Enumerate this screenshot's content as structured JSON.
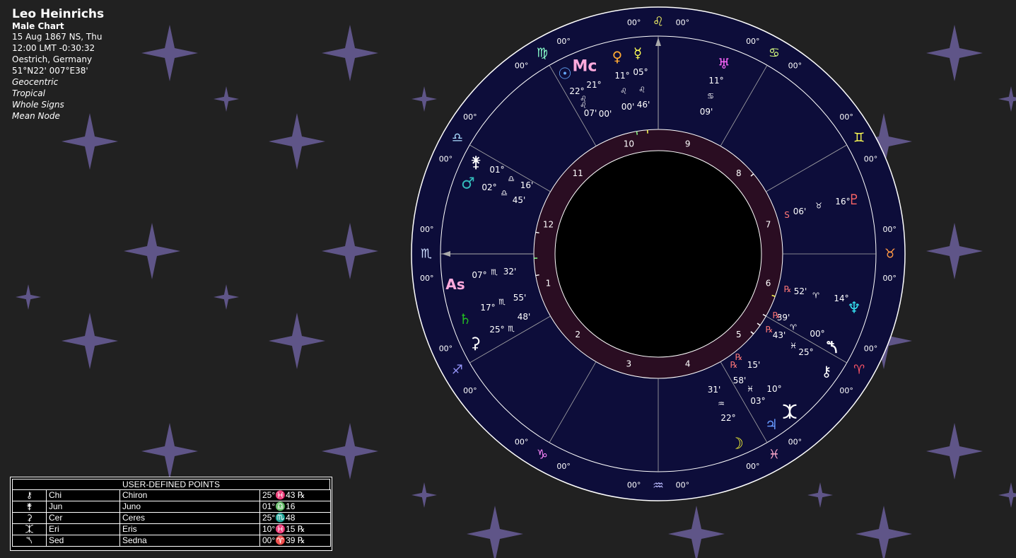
{
  "chart_info": {
    "name": "Leo Heinrichs",
    "chart_type": "Male Chart",
    "date": "15 Aug 1867 NS, Thu",
    "time": "12:00  LMT -0:30:32",
    "place": "Oestrich, Germany",
    "coords": "51°N22' 007°E38'",
    "settings": [
      "Geocentric",
      "Tropical",
      "Whole Signs",
      "Mean Node"
    ]
  },
  "colors": {
    "background": "#212121",
    "wheel_outer": "#0d0d3a",
    "house_ring": "#2a0d22",
    "ring_line": "#ffffff",
    "star": "#5f5588"
  },
  "wheel": {
    "house_numbers": [
      "1",
      "2",
      "3",
      "4",
      "5",
      "6",
      "7",
      "8",
      "9",
      "10",
      "11",
      "12"
    ],
    "degree_marks": [
      "00°",
      "00°",
      "00°",
      "00°",
      "00°",
      "00°",
      "00°",
      "00°",
      "00°",
      "00°",
      "00°",
      "00°",
      "00°",
      "00°",
      "00°",
      "00°",
      "00°",
      "00°",
      "00°",
      "00°",
      "00°",
      "00°",
      "00°",
      "00°"
    ],
    "signs": [
      {
        "glyph": "♌",
        "name": "leo-sign-icon",
        "color": "#ffff66"
      },
      {
        "glyph": "♋",
        "name": "cancer-sign-icon",
        "color": "#d8ff80"
      },
      {
        "glyph": "♊",
        "name": "gemini-sign-icon",
        "color": "#ffff55"
      },
      {
        "glyph": "♉",
        "name": "taurus-sign-icon",
        "color": "#ff9944"
      },
      {
        "glyph": "♈",
        "name": "aries-sign-icon",
        "color": "#ff5566"
      },
      {
        "glyph": "♓",
        "name": "pisces-sign-icon",
        "color": "#ffaacc"
      },
      {
        "glyph": "♒",
        "name": "aquarius-sign-icon",
        "color": "#bbbbff"
      },
      {
        "glyph": "♑",
        "name": "capricorn-sign-icon",
        "color": "#ff88ff"
      },
      {
        "glyph": "♐",
        "name": "sagittarius-sign-icon",
        "color": "#9999ff"
      },
      {
        "glyph": "♏",
        "name": "scorpio-sign-icon",
        "color": "#ccddff"
      },
      {
        "glyph": "♎",
        "name": "libra-sign-icon",
        "color": "#aaddff"
      },
      {
        "glyph": "♍",
        "name": "virgo-sign-icon",
        "color": "#88ffcc"
      }
    ]
  },
  "points": {
    "mc": {
      "glyph": "Mc",
      "deg": "21°",
      "sign": "♌",
      "min": "07'",
      "color": "#ffaadd"
    },
    "sun": {
      "glyph": "☉",
      "deg": "22°",
      "sign": "♌",
      "min": "00'",
      "color": "#66aaff"
    },
    "venus": {
      "glyph": "♀",
      "deg": "11°",
      "sign": "♌",
      "min": "00'",
      "color": "#ffaa33"
    },
    "mercury": {
      "glyph": "☿",
      "deg": "05°",
      "sign": "♌",
      "min": "46'",
      "color": "#ffff55"
    },
    "uranus": {
      "glyph": "♅",
      "deg": "11°",
      "sign": "♋",
      "min": "09'",
      "color": "#ff66ff"
    },
    "pluto": {
      "glyph": "♇",
      "deg": "16°",
      "sign": "♉",
      "min": "06'",
      "retro": "S",
      "color": "#ff6666"
    },
    "neptune": {
      "glyph": "♆",
      "deg": "14°",
      "sign": "♈",
      "min": "52'",
      "retro": "℞",
      "color": "#33ddee"
    },
    "sedna": {
      "glyph": "⯲",
      "deg": "00°",
      "sign": "♈",
      "min": "39'",
      "retro": "℞",
      "color": "#ffffff"
    },
    "chiron": {
      "glyph": "⚷",
      "deg": "25°",
      "sign": "♓",
      "min": "43'",
      "retro": "℞",
      "color": "#ffffff"
    },
    "eris": {
      "glyph": "⯰",
      "deg": "10°",
      "sign": "♓",
      "min": "15'",
      "retro": "℞",
      "color": "#ffffff"
    },
    "jupiter": {
      "glyph": "♃",
      "deg": "03°",
      "sign": "♓",
      "min": "58'",
      "retro": "℞",
      "color": "#6699ff"
    },
    "moon": {
      "glyph": "☽",
      "deg": "22°",
      "sign": "♒",
      "min": "31'",
      "color": "#ffff33"
    },
    "ceres": {
      "glyph": "⚳",
      "deg": "25°",
      "sign": "♏",
      "min": "48'",
      "color": "#ffffff"
    },
    "saturn": {
      "glyph": "♄",
      "deg": "17°",
      "sign": "♏",
      "min": "55'",
      "color": "#22bb22"
    },
    "asc": {
      "glyph": "As",
      "deg": "07°",
      "sign": "♏",
      "min": "32'",
      "color": "#ffaadd"
    },
    "mars": {
      "glyph": "♂",
      "deg": "02°",
      "sign": "♎",
      "min": "45'",
      "color": "#33bbbb"
    },
    "juno": {
      "glyph": "⚵",
      "deg": "01°",
      "sign": "♎",
      "min": "16'",
      "color": "#ffffff"
    }
  },
  "user_defined_points": {
    "title": "USER-DEFINED POINTS",
    "rows": [
      {
        "glyph": "⚷",
        "abbr": "Chi",
        "name": "Chiron",
        "position": "25°♓43 ℞"
      },
      {
        "glyph": "⚵",
        "abbr": "Jun",
        "name": "Juno",
        "position": "01°♎16"
      },
      {
        "glyph": "⚳",
        "abbr": "Cer",
        "name": "Ceres",
        "position": "25°♏48"
      },
      {
        "glyph": "⯰",
        "abbr": "Eri",
        "name": "Eris",
        "position": "10°♓15 ℞"
      },
      {
        "glyph": "⯲",
        "abbr": "Sed",
        "name": "Sedna",
        "position": "00°♈39 ℞"
      }
    ]
  }
}
